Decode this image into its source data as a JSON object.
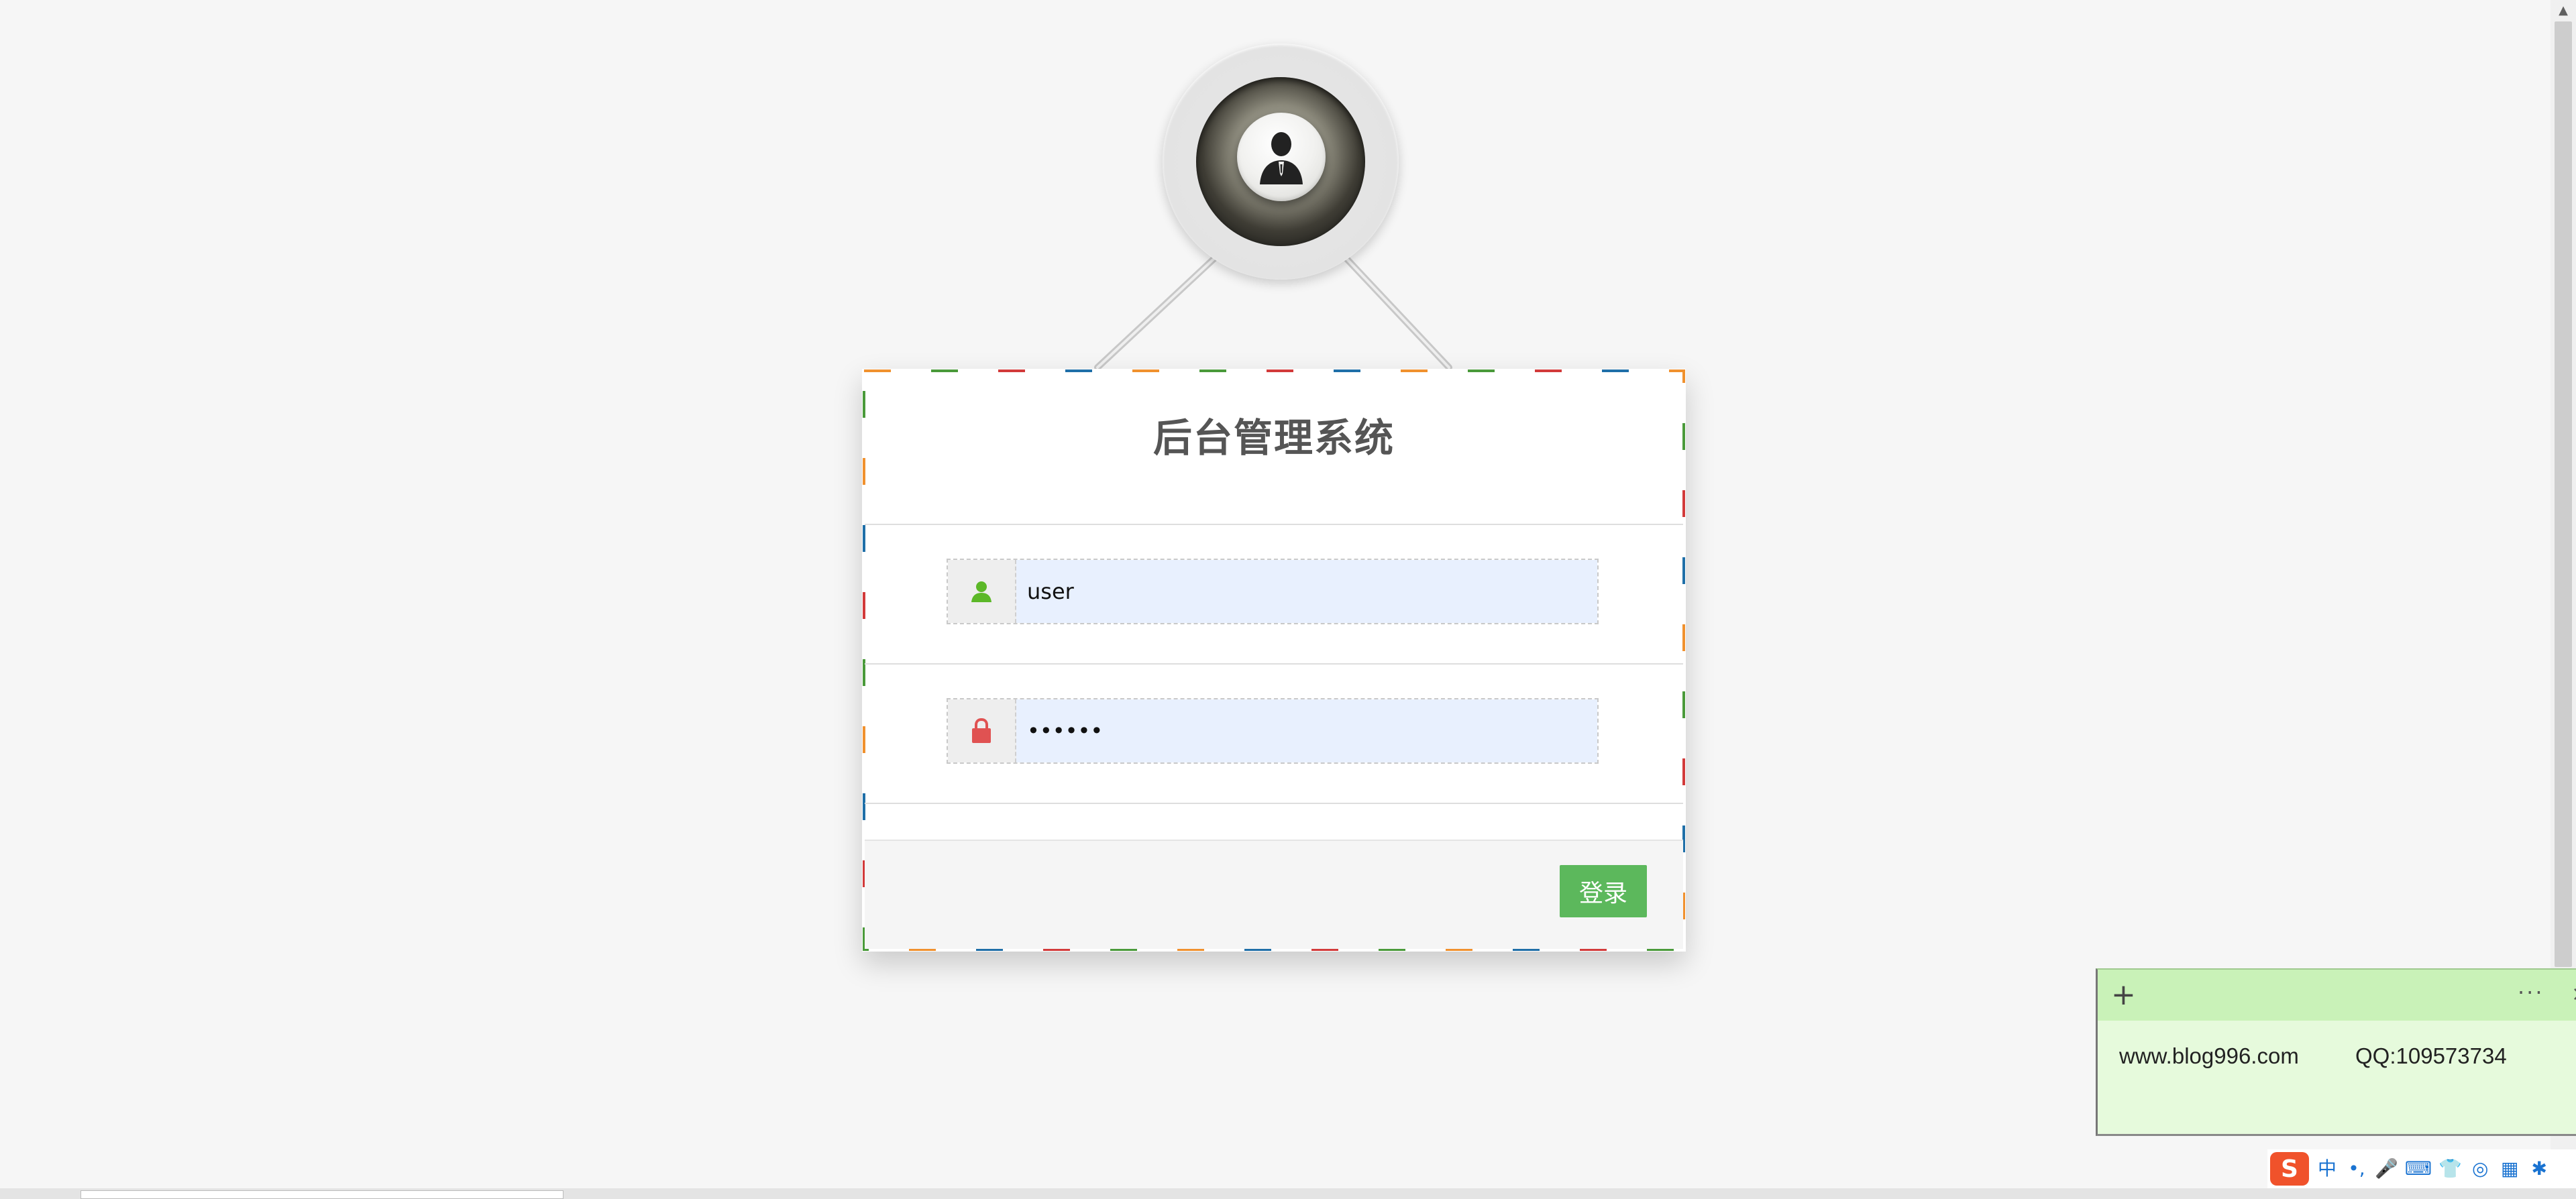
{
  "app": {
    "title": "后台管理系统"
  },
  "login": {
    "username_value": "user",
    "username_icon": "user-icon",
    "password_value": "••••••",
    "password_icon": "lock-icon",
    "submit_label": "登录",
    "avatar_icon": "person-icon"
  },
  "note": {
    "add_icon": "+",
    "menu_icon": "···",
    "close_icon": "×",
    "site": "www.blog996.com",
    "qq": "QQ:109573734"
  },
  "ime": {
    "logo": "S",
    "items": [
      "中",
      "•,",
      "🎤",
      "⌨",
      "👕",
      "◎",
      "▦",
      "✱"
    ]
  },
  "colors": {
    "accent_green": "#5cb85c",
    "user_icon": "#5cb828",
    "lock_icon": "#e05252",
    "input_bg": "#e8f0fe",
    "border_dash": [
      "#f0912e",
      "#4a9a3a",
      "#d23a3a",
      "#1f6fa8"
    ]
  }
}
